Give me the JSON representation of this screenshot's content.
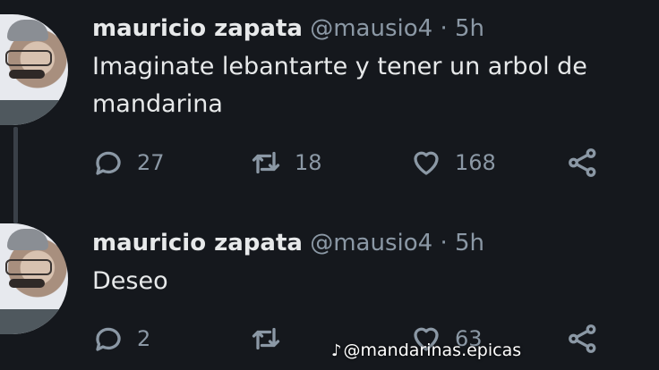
{
  "tweets": [
    {
      "display_name": "mauricio zapata",
      "handle": "@mausio4",
      "separator": "·",
      "time": "5h",
      "text": "Imaginate lebantarte y tener un arbol de mandarina",
      "replies": "27",
      "retweets": "18",
      "likes": "168"
    },
    {
      "display_name": "mauricio zapata",
      "handle": "@mausio4",
      "separator": "·",
      "time": "5h",
      "text": "Deseo",
      "replies": "2",
      "retweets": "",
      "likes": "63"
    }
  ],
  "watermark": {
    "icon": "tiktok-icon",
    "text": "@mandarinas.epicas"
  },
  "colors": {
    "background": "#15181d",
    "text": "#e7e9ea",
    "muted": "#8b98a5",
    "thread_line": "#3a4048"
  }
}
